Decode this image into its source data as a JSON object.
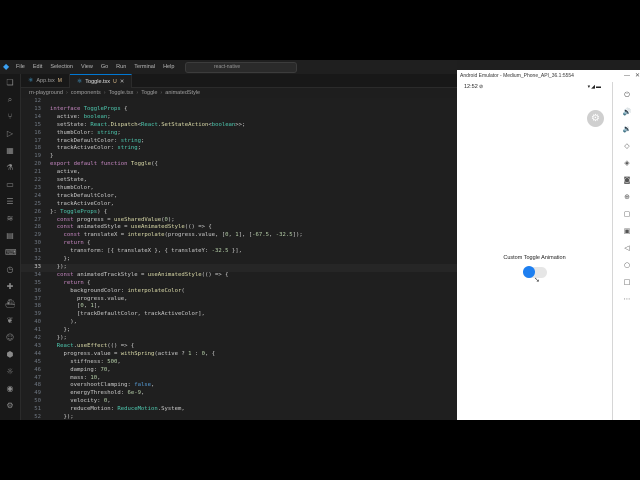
{
  "window": {
    "menu": [
      "File",
      "Edit",
      "Selection",
      "View",
      "Go",
      "Run",
      "Terminal",
      "Help"
    ],
    "search_text": "react-native"
  },
  "tabs": [
    {
      "label": "App.tsx",
      "badge": "M",
      "active": false
    },
    {
      "label": "Toggle.tsx",
      "badge": "U",
      "active": true
    }
  ],
  "breadcrumb": [
    "rn-playground",
    "components",
    "Toggle.tsx",
    "Toggle",
    "animatedStyle"
  ],
  "editor": {
    "current_line": 33,
    "lines": [
      {
        "n": "12",
        "t": ""
      },
      {
        "n": "13",
        "t": "interface ToggleProps {"
      },
      {
        "n": "14",
        "t": "  active: boolean;"
      },
      {
        "n": "15",
        "t": "  setState: React.Dispatch<React.SetStateAction<boolean>>;"
      },
      {
        "n": "16",
        "t": "  thumbColor: string;"
      },
      {
        "n": "17",
        "t": "  trackDefaultColor: string;"
      },
      {
        "n": "18",
        "t": "  trackActiveColor: string;"
      },
      {
        "n": "19",
        "t": "}"
      },
      {
        "n": "20",
        "t": "export default function Toggle({"
      },
      {
        "n": "21",
        "t": "  active,"
      },
      {
        "n": "22",
        "t": "  setState,"
      },
      {
        "n": "23",
        "t": "  thumbColor,"
      },
      {
        "n": "24",
        "t": "  trackDefaultColor,"
      },
      {
        "n": "25",
        "t": "  trackActiveColor,"
      },
      {
        "n": "26",
        "t": "}: ToggleProps) {"
      },
      {
        "n": "27",
        "t": "  const progress = useSharedValue(0);"
      },
      {
        "n": "28",
        "t": "  const animatedStyle = useAnimatedStyle(() => {"
      },
      {
        "n": "29",
        "t": "    const translateX = interpolate(progress.value, [0, 1], [-67.5, -32.5]);"
      },
      {
        "n": "30",
        "t": "    return {"
      },
      {
        "n": "31",
        "t": "      transform: [{ translateX }, { translateY: -32.5 }],"
      },
      {
        "n": "32",
        "t": "    };"
      },
      {
        "n": "33",
        "t": "  });"
      },
      {
        "n": "34",
        "t": "  const animatedTrackStyle = useAnimatedStyle(() => {"
      },
      {
        "n": "35",
        "t": "    return {"
      },
      {
        "n": "36",
        "t": "      backgroundColor: interpolateColor("
      },
      {
        "n": "37",
        "t": "        progress.value,"
      },
      {
        "n": "38",
        "t": "        [0, 1],"
      },
      {
        "n": "39",
        "t": "        [trackDefaultColor, trackActiveColor],"
      },
      {
        "n": "40",
        "t": "      ),"
      },
      {
        "n": "41",
        "t": "    };"
      },
      {
        "n": "42",
        "t": "  });"
      },
      {
        "n": "43",
        "t": "  React.useEffect(() => {"
      },
      {
        "n": "44",
        "t": "    progress.value = withSpring(active ? 1 : 0, {"
      },
      {
        "n": "45",
        "t": "      stiffness: 500,"
      },
      {
        "n": "46",
        "t": "      damping: 70,"
      },
      {
        "n": "47",
        "t": "      mass: 10,"
      },
      {
        "n": "48",
        "t": "      overshootClamping: false,"
      },
      {
        "n": "49",
        "t": "      energyThreshold: 6e-9,"
      },
      {
        "n": "50",
        "t": "      velocity: 0,"
      },
      {
        "n": "51",
        "t": "      reduceMotion: ReduceMotion.System,"
      },
      {
        "n": "52",
        "t": "    });"
      }
    ]
  },
  "emulator": {
    "title": "Android Emulator - Medium_Phone_API_36.1:5554",
    "time": "12:52",
    "toggle_label": "Custom Toggle Animation",
    "toggle_active": false
  },
  "colors": {
    "accent": "#1e7ff0",
    "editor_bg": "#1f1f1f"
  }
}
